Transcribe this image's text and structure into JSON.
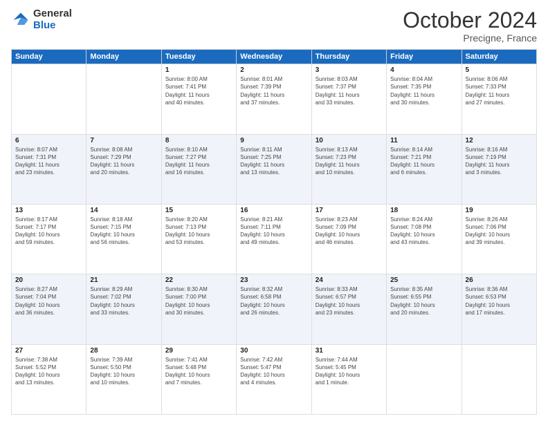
{
  "header": {
    "logo_general": "General",
    "logo_blue": "Blue",
    "month_title": "October 2024",
    "subtitle": "Precigne, France"
  },
  "days_of_week": [
    "Sunday",
    "Monday",
    "Tuesday",
    "Wednesday",
    "Thursday",
    "Friday",
    "Saturday"
  ],
  "weeks": [
    [
      {
        "day": "",
        "info": ""
      },
      {
        "day": "",
        "info": ""
      },
      {
        "day": "1",
        "info": "Sunrise: 8:00 AM\nSunset: 7:41 PM\nDaylight: 11 hours\nand 40 minutes."
      },
      {
        "day": "2",
        "info": "Sunrise: 8:01 AM\nSunset: 7:39 PM\nDaylight: 11 hours\nand 37 minutes."
      },
      {
        "day": "3",
        "info": "Sunrise: 8:03 AM\nSunset: 7:37 PM\nDaylight: 11 hours\nand 33 minutes."
      },
      {
        "day": "4",
        "info": "Sunrise: 8:04 AM\nSunset: 7:35 PM\nDaylight: 11 hours\nand 30 minutes."
      },
      {
        "day": "5",
        "info": "Sunrise: 8:06 AM\nSunset: 7:33 PM\nDaylight: 11 hours\nand 27 minutes."
      }
    ],
    [
      {
        "day": "6",
        "info": "Sunrise: 8:07 AM\nSunset: 7:31 PM\nDaylight: 11 hours\nand 23 minutes."
      },
      {
        "day": "7",
        "info": "Sunrise: 8:08 AM\nSunset: 7:29 PM\nDaylight: 11 hours\nand 20 minutes."
      },
      {
        "day": "8",
        "info": "Sunrise: 8:10 AM\nSunset: 7:27 PM\nDaylight: 11 hours\nand 16 minutes."
      },
      {
        "day": "9",
        "info": "Sunrise: 8:11 AM\nSunset: 7:25 PM\nDaylight: 11 hours\nand 13 minutes."
      },
      {
        "day": "10",
        "info": "Sunrise: 8:13 AM\nSunset: 7:23 PM\nDaylight: 11 hours\nand 10 minutes."
      },
      {
        "day": "11",
        "info": "Sunrise: 8:14 AM\nSunset: 7:21 PM\nDaylight: 11 hours\nand 6 minutes."
      },
      {
        "day": "12",
        "info": "Sunrise: 8:16 AM\nSunset: 7:19 PM\nDaylight: 11 hours\nand 3 minutes."
      }
    ],
    [
      {
        "day": "13",
        "info": "Sunrise: 8:17 AM\nSunset: 7:17 PM\nDaylight: 10 hours\nand 59 minutes."
      },
      {
        "day": "14",
        "info": "Sunrise: 8:18 AM\nSunset: 7:15 PM\nDaylight: 10 hours\nand 56 minutes."
      },
      {
        "day": "15",
        "info": "Sunrise: 8:20 AM\nSunset: 7:13 PM\nDaylight: 10 hours\nand 53 minutes."
      },
      {
        "day": "16",
        "info": "Sunrise: 8:21 AM\nSunset: 7:11 PM\nDaylight: 10 hours\nand 49 minutes."
      },
      {
        "day": "17",
        "info": "Sunrise: 8:23 AM\nSunset: 7:09 PM\nDaylight: 10 hours\nand 46 minutes."
      },
      {
        "day": "18",
        "info": "Sunrise: 8:24 AM\nSunset: 7:08 PM\nDaylight: 10 hours\nand 43 minutes."
      },
      {
        "day": "19",
        "info": "Sunrise: 8:26 AM\nSunset: 7:06 PM\nDaylight: 10 hours\nand 39 minutes."
      }
    ],
    [
      {
        "day": "20",
        "info": "Sunrise: 8:27 AM\nSunset: 7:04 PM\nDaylight: 10 hours\nand 36 minutes."
      },
      {
        "day": "21",
        "info": "Sunrise: 8:29 AM\nSunset: 7:02 PM\nDaylight: 10 hours\nand 33 minutes."
      },
      {
        "day": "22",
        "info": "Sunrise: 8:30 AM\nSunset: 7:00 PM\nDaylight: 10 hours\nand 30 minutes."
      },
      {
        "day": "23",
        "info": "Sunrise: 8:32 AM\nSunset: 6:58 PM\nDaylight: 10 hours\nand 26 minutes."
      },
      {
        "day": "24",
        "info": "Sunrise: 8:33 AM\nSunset: 6:57 PM\nDaylight: 10 hours\nand 23 minutes."
      },
      {
        "day": "25",
        "info": "Sunrise: 8:35 AM\nSunset: 6:55 PM\nDaylight: 10 hours\nand 20 minutes."
      },
      {
        "day": "26",
        "info": "Sunrise: 8:36 AM\nSunset: 6:53 PM\nDaylight: 10 hours\nand 17 minutes."
      }
    ],
    [
      {
        "day": "27",
        "info": "Sunrise: 7:38 AM\nSunset: 5:52 PM\nDaylight: 10 hours\nand 13 minutes."
      },
      {
        "day": "28",
        "info": "Sunrise: 7:39 AM\nSunset: 5:50 PM\nDaylight: 10 hours\nand 10 minutes."
      },
      {
        "day": "29",
        "info": "Sunrise: 7:41 AM\nSunset: 5:48 PM\nDaylight: 10 hours\nand 7 minutes."
      },
      {
        "day": "30",
        "info": "Sunrise: 7:42 AM\nSunset: 5:47 PM\nDaylight: 10 hours\nand 4 minutes."
      },
      {
        "day": "31",
        "info": "Sunrise: 7:44 AM\nSunset: 5:45 PM\nDaylight: 10 hours\nand 1 minute."
      },
      {
        "day": "",
        "info": ""
      },
      {
        "day": "",
        "info": ""
      }
    ]
  ]
}
